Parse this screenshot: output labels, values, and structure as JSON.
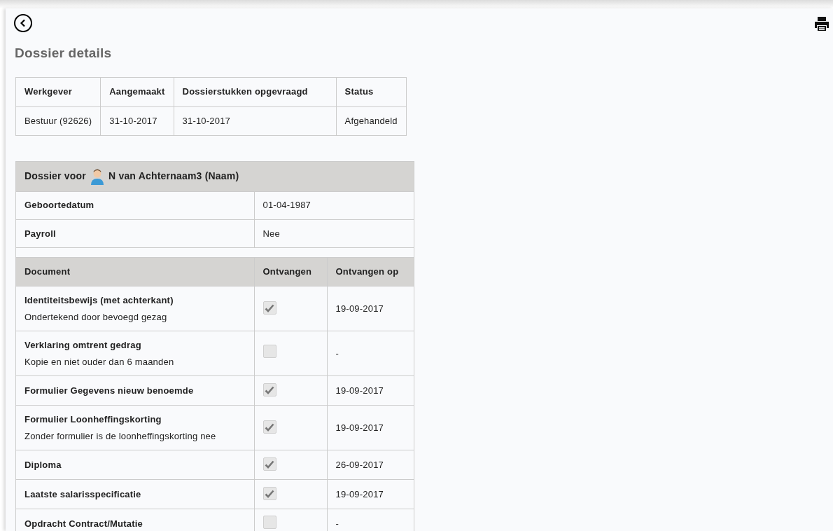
{
  "title": "Dossier details",
  "summary": {
    "columns": [
      "Werkgever",
      "Aangemaakt",
      "Dossierstukken opgevraagd",
      "Status"
    ],
    "row": [
      "Bestuur (92626)",
      "31-10-2017",
      "31-10-2017",
      "Afgehandeld"
    ]
  },
  "dossier": {
    "heading_prefix": "Dossier voor",
    "person": "N van Achternaam3 (Naam)",
    "fields": [
      {
        "label": "Geboortedatum",
        "value": "01-04-1987"
      },
      {
        "label": "Payroll",
        "value": "Nee"
      }
    ],
    "columns": [
      "Document",
      "Ontvangen",
      "Ontvangen op"
    ],
    "documents": [
      {
        "title": "Identiteitsbewijs (met achterkant)",
        "note": "Ondertekend door bevoegd gezag",
        "checked": true,
        "date": "19-09-2017"
      },
      {
        "title": "Verklaring omtrent gedrag",
        "note": "Kopie en niet ouder dan 6 maanden",
        "checked": false,
        "date": "-"
      },
      {
        "title": "Formulier Gegevens nieuw benoemde",
        "checked": true,
        "date": "19-09-2017"
      },
      {
        "title": "Formulier Loonheffingskorting",
        "note": "Zonder formulier is de loonheffingskorting nee",
        "checked": true,
        "date": "19-09-2017"
      },
      {
        "title": "Diploma",
        "checked": true,
        "date": "26-09-2017"
      },
      {
        "title": "Laatste salarisspecificatie",
        "checked": true,
        "date": "19-09-2017"
      },
      {
        "title": "Opdracht Contract/Mutatie",
        "checked": false,
        "date": "-"
      }
    ]
  }
}
